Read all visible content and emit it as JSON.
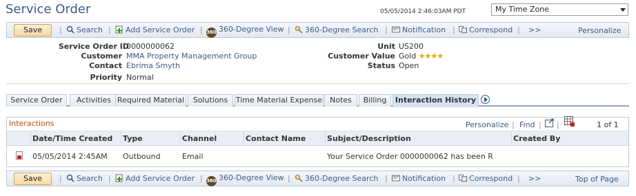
{
  "header": {
    "title": "Service Order",
    "datetime": "05/05/2014 2:46:03AM PDT",
    "timezone": "My Time Zone"
  },
  "toolbar": {
    "save": "Save",
    "search": "Search",
    "add_service_order": "Add Service Order",
    "degree_view": "360-Degree View",
    "degree_search": "360-Degree Search",
    "notification": "Notification",
    "correspond": "Correspond",
    "more": ">>",
    "personalize": "Personalize",
    "top_of_page": "Top of Page",
    "sep": "|",
    "badge_360": "360"
  },
  "fields": {
    "service_order_id_label": "Service Order ID",
    "service_order_id": "0000000062",
    "customer_label": "Customer",
    "customer": "MMA Property Management Group",
    "contact_label": "Contact",
    "contact": "Ebrima Smyth",
    "priority_label": "Priority",
    "priority": "Normal",
    "unit_label": "Unit",
    "unit": "US200",
    "customer_value_label": "Customer Value",
    "customer_value": "Gold",
    "customer_value_stars": 4,
    "status_label": "Status",
    "status": "Open"
  },
  "tabs": [
    {
      "label": "Service Order"
    },
    {
      "label": "Activities"
    },
    {
      "label": "Required Material"
    },
    {
      "label": "Solutions"
    },
    {
      "label": "Time Material Expense"
    },
    {
      "label": "Notes"
    },
    {
      "label": "Billing"
    },
    {
      "label": "Interaction History",
      "active": true
    }
  ],
  "grid": {
    "title": "Interactions",
    "personalize": "Personalize",
    "find": "Find",
    "sep": "|",
    "pager": "1 of 1",
    "columns": [
      "Date/Time Created",
      "Type",
      "Channel",
      "Contact Name",
      "Subject/Description",
      "Created By"
    ],
    "rows": [
      {
        "datetime": "05/05/2014  2:45AM",
        "type": "Outbound",
        "channel": "Email",
        "contact_name": "",
        "subject": "Your Service Order 0000000062 has been R",
        "created_by": ""
      }
    ]
  },
  "colors": {
    "link": "#3c5a86",
    "section_title": "#c0480a",
    "save_button": "#f7d9a3",
    "header_bg": "#e9eef5"
  }
}
